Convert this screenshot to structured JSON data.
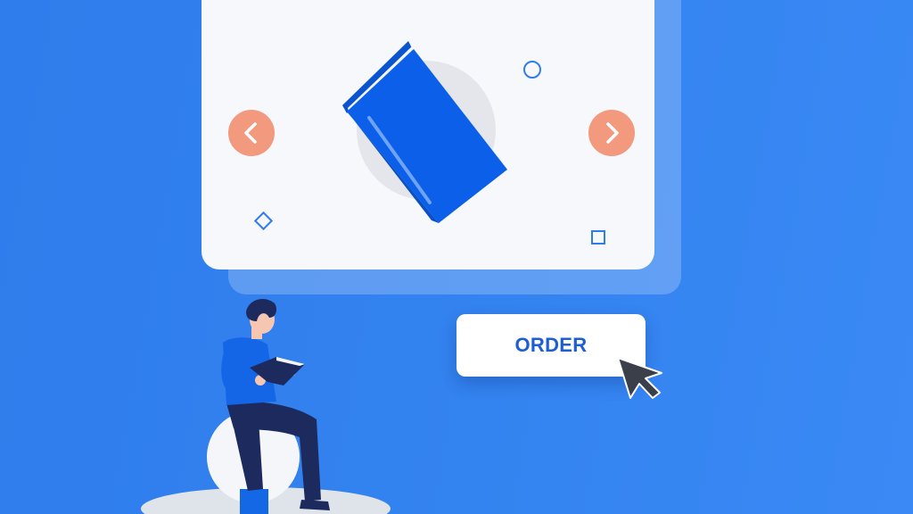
{
  "order_button": {
    "label": "ORDER"
  },
  "carousel": {
    "prev_icon": "chevron-left-icon",
    "next_icon": "chevron-right-icon",
    "slide_icon": "book-icon"
  },
  "colors": {
    "background": "#3383f0",
    "card": "#f6f8fc",
    "accent_book": "#0b5fe8",
    "nav_button": "#f2997e",
    "order_text": "#1d5fd1"
  }
}
